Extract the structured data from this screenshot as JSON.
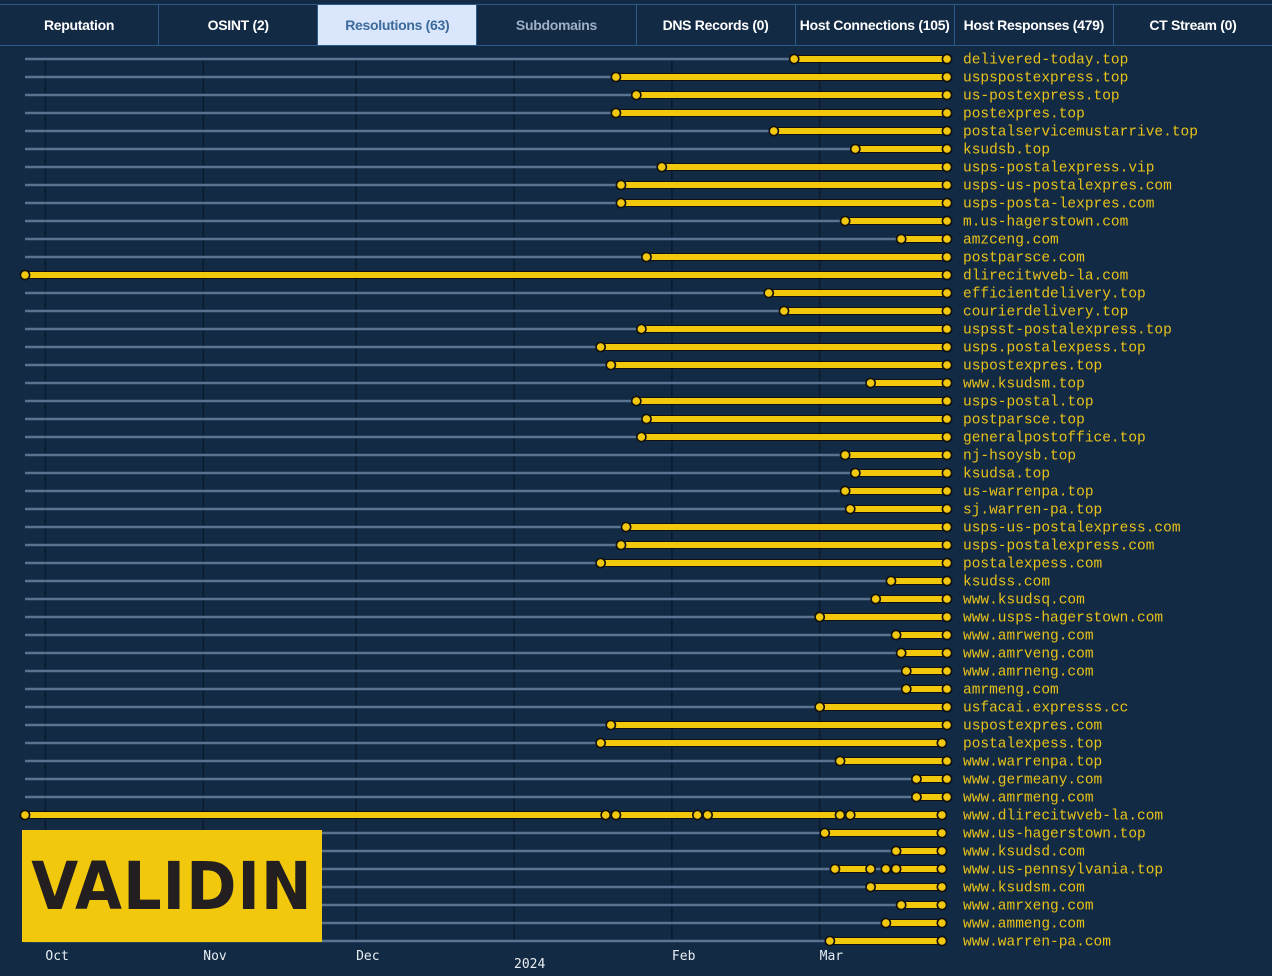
{
  "tabs": [
    {
      "label": "Reputation",
      "state": "normal"
    },
    {
      "label": "OSINT (2)",
      "state": "normal"
    },
    {
      "label": "Resolutions (63)",
      "state": "active"
    },
    {
      "label": "Subdomains",
      "state": "dim"
    },
    {
      "label": "DNS Records (0)",
      "state": "normal"
    },
    {
      "label": "Host Connections (105)",
      "state": "normal"
    },
    {
      "label": "Host Responses (479)",
      "state": "normal"
    },
    {
      "label": "CT Stream (0)",
      "state": "normal"
    }
  ],
  "logo": {
    "text": "VALIDIN"
  },
  "colors": {
    "background": "#122a44",
    "accent": "#f2c80d",
    "row_line": "#5a7390",
    "label": "#e8c21a",
    "active_tab_bg": "#d9e6fb",
    "active_tab_text": "#3c6a9c"
  },
  "chart_data": {
    "type": "timeline",
    "title": "",
    "xlabel": "",
    "ylabel": "",
    "x_range": [
      "2023-09-27",
      "2024-03-28"
    ],
    "x_ticks": [
      {
        "date": "2023-10-01",
        "label": "Oct"
      },
      {
        "date": "2023-11-01",
        "label": "Nov"
      },
      {
        "date": "2023-12-01",
        "label": "Dec"
      },
      {
        "date": "2024-01-01",
        "label": "2024"
      },
      {
        "date": "2024-02-01",
        "label": "Feb"
      },
      {
        "date": "2024-03-01",
        "label": "Mar"
      }
    ],
    "grid": "vertical lines at month boundaries",
    "rows": [
      {
        "domain": "delivered-today.top",
        "segments": [
          [
            "2024-02-25",
            "2024-03-26"
          ]
        ]
      },
      {
        "domain": "uspspostexpress.top",
        "segments": [
          [
            "2024-01-21",
            "2024-03-26"
          ]
        ]
      },
      {
        "domain": "us-postexpress.top",
        "segments": [
          [
            "2024-01-25",
            "2024-03-26"
          ]
        ]
      },
      {
        "domain": "postexpres.top",
        "segments": [
          [
            "2024-01-21",
            "2024-03-26"
          ]
        ]
      },
      {
        "domain": "postalservicemustarrive.top",
        "segments": [
          [
            "2024-02-21",
            "2024-03-26"
          ]
        ]
      },
      {
        "domain": "ksudsb.top",
        "segments": [
          [
            "2024-03-08",
            "2024-03-26"
          ]
        ]
      },
      {
        "domain": "usps-postalexpress.vip",
        "segments": [
          [
            "2024-01-30",
            "2024-03-26"
          ]
        ]
      },
      {
        "domain": "usps-us-postalexpres.com",
        "segments": [
          [
            "2024-01-22",
            "2024-03-26"
          ]
        ]
      },
      {
        "domain": "usps-posta-lexpres.com",
        "segments": [
          [
            "2024-01-22",
            "2024-03-26"
          ]
        ]
      },
      {
        "domain": "m.us-hagerstown.com",
        "segments": [
          [
            "2024-03-06",
            "2024-03-26"
          ]
        ]
      },
      {
        "domain": "amzceng.com",
        "segments": [
          [
            "2024-03-17",
            "2024-03-26"
          ]
        ]
      },
      {
        "domain": "postparsce.com",
        "segments": [
          [
            "2024-01-27",
            "2024-03-26"
          ]
        ]
      },
      {
        "domain": "dlirecitwveb-la.com",
        "segments": [
          [
            "2023-09-27",
            "2024-03-26"
          ]
        ]
      },
      {
        "domain": "efficientdelivery.top",
        "segments": [
          [
            "2024-02-20",
            "2024-03-26"
          ]
        ]
      },
      {
        "domain": "courierdelivery.top",
        "segments": [
          [
            "2024-02-23",
            "2024-03-26"
          ]
        ]
      },
      {
        "domain": "uspsst-postalexpress.top",
        "segments": [
          [
            "2024-01-26",
            "2024-03-26"
          ]
        ]
      },
      {
        "domain": "usps.postalexpess.top",
        "segments": [
          [
            "2024-01-18",
            "2024-03-26"
          ]
        ]
      },
      {
        "domain": "uspostexpres.top",
        "segments": [
          [
            "2024-01-20",
            "2024-03-26"
          ]
        ]
      },
      {
        "domain": "www.ksudsm.top",
        "segments": [
          [
            "2024-03-11",
            "2024-03-26"
          ]
        ]
      },
      {
        "domain": "usps-postal.top",
        "segments": [
          [
            "2024-01-25",
            "2024-03-26"
          ]
        ]
      },
      {
        "domain": "postparsce.top",
        "segments": [
          [
            "2024-01-27",
            "2024-03-26"
          ]
        ]
      },
      {
        "domain": "generalpostoffice.top",
        "segments": [
          [
            "2024-01-26",
            "2024-03-26"
          ]
        ]
      },
      {
        "domain": "nj-hsoysb.top",
        "segments": [
          [
            "2024-03-06",
            "2024-03-26"
          ]
        ]
      },
      {
        "domain": "ksudsa.top",
        "segments": [
          [
            "2024-03-08",
            "2024-03-26"
          ]
        ]
      },
      {
        "domain": "us-warrenpa.top",
        "segments": [
          [
            "2024-03-06",
            "2024-03-26"
          ]
        ]
      },
      {
        "domain": "sj.warren-pa.top",
        "segments": [
          [
            "2024-03-07",
            "2024-03-26"
          ]
        ]
      },
      {
        "domain": "usps-us-postalexpress.com",
        "segments": [
          [
            "2024-01-23",
            "2024-03-26"
          ]
        ]
      },
      {
        "domain": "usps-postalexpress.com",
        "segments": [
          [
            "2024-01-22",
            "2024-03-26"
          ]
        ]
      },
      {
        "domain": "postalexpess.com",
        "segments": [
          [
            "2024-01-18",
            "2024-03-26"
          ]
        ]
      },
      {
        "domain": "ksudss.com",
        "segments": [
          [
            "2024-03-15",
            "2024-03-26"
          ]
        ]
      },
      {
        "domain": "www.ksudsq.com",
        "segments": [
          [
            "2024-03-12",
            "2024-03-26"
          ]
        ]
      },
      {
        "domain": "www.usps-hagerstown.com",
        "segments": [
          [
            "2024-03-01",
            "2024-03-26"
          ]
        ]
      },
      {
        "domain": "www.amrweng.com",
        "segments": [
          [
            "2024-03-16",
            "2024-03-26"
          ]
        ]
      },
      {
        "domain": "www.amrveng.com",
        "segments": [
          [
            "2024-03-17",
            "2024-03-26"
          ]
        ]
      },
      {
        "domain": "www.amrneng.com",
        "segments": [
          [
            "2024-03-18",
            "2024-03-26"
          ]
        ]
      },
      {
        "domain": "amrmeng.com",
        "segments": [
          [
            "2024-03-18",
            "2024-03-26"
          ]
        ]
      },
      {
        "domain": "usfacai.expresss.cc",
        "segments": [
          [
            "2024-03-01",
            "2024-03-26"
          ]
        ]
      },
      {
        "domain": "uspostexpres.com",
        "segments": [
          [
            "2024-01-20",
            "2024-03-26"
          ]
        ]
      },
      {
        "domain": "postalexpess.top",
        "segments": [
          [
            "2024-01-18",
            "2024-03-25"
          ]
        ]
      },
      {
        "domain": "www.warrenpa.top",
        "segments": [
          [
            "2024-03-05",
            "2024-03-26"
          ]
        ]
      },
      {
        "domain": "www.germeany.com",
        "segments": [
          [
            "2024-03-20",
            "2024-03-26"
          ]
        ]
      },
      {
        "domain": "www.amrmeng.com",
        "segments": [
          [
            "2024-03-20",
            "2024-03-26"
          ]
        ]
      },
      {
        "domain": "www.dlirecitwveb-la.com",
        "segments": [
          [
            "2023-09-27",
            "2024-01-19"
          ],
          [
            "2024-01-21",
            "2024-02-06"
          ],
          [
            "2024-02-08",
            "2024-03-05"
          ],
          [
            "2024-03-07",
            "2024-03-25"
          ]
        ]
      },
      {
        "domain": "www.us-hagerstown.top",
        "segments": [
          [
            "2024-03-02",
            "2024-03-25"
          ]
        ]
      },
      {
        "domain": "www.ksudsd.com",
        "segments": [
          [
            "2024-03-16",
            "2024-03-25"
          ]
        ]
      },
      {
        "domain": "www.us-pennsylvania.top",
        "segments": [
          [
            "2024-03-04",
            "2024-03-11"
          ],
          [
            "2024-03-14",
            "2024-03-14"
          ],
          [
            "2024-03-16",
            "2024-03-25"
          ]
        ]
      },
      {
        "domain": "www.ksudsm.com",
        "segments": [
          [
            "2024-03-11",
            "2024-03-25"
          ]
        ]
      },
      {
        "domain": "www.amrxeng.com",
        "segments": [
          [
            "2024-03-17",
            "2024-03-25"
          ]
        ]
      },
      {
        "domain": "www.ammeng.com",
        "segments": [
          [
            "2024-03-14",
            "2024-03-25"
          ]
        ]
      },
      {
        "domain": "www.warren-pa.com",
        "segments": [
          [
            "2024-03-03",
            "2024-03-25"
          ]
        ]
      }
    ]
  }
}
